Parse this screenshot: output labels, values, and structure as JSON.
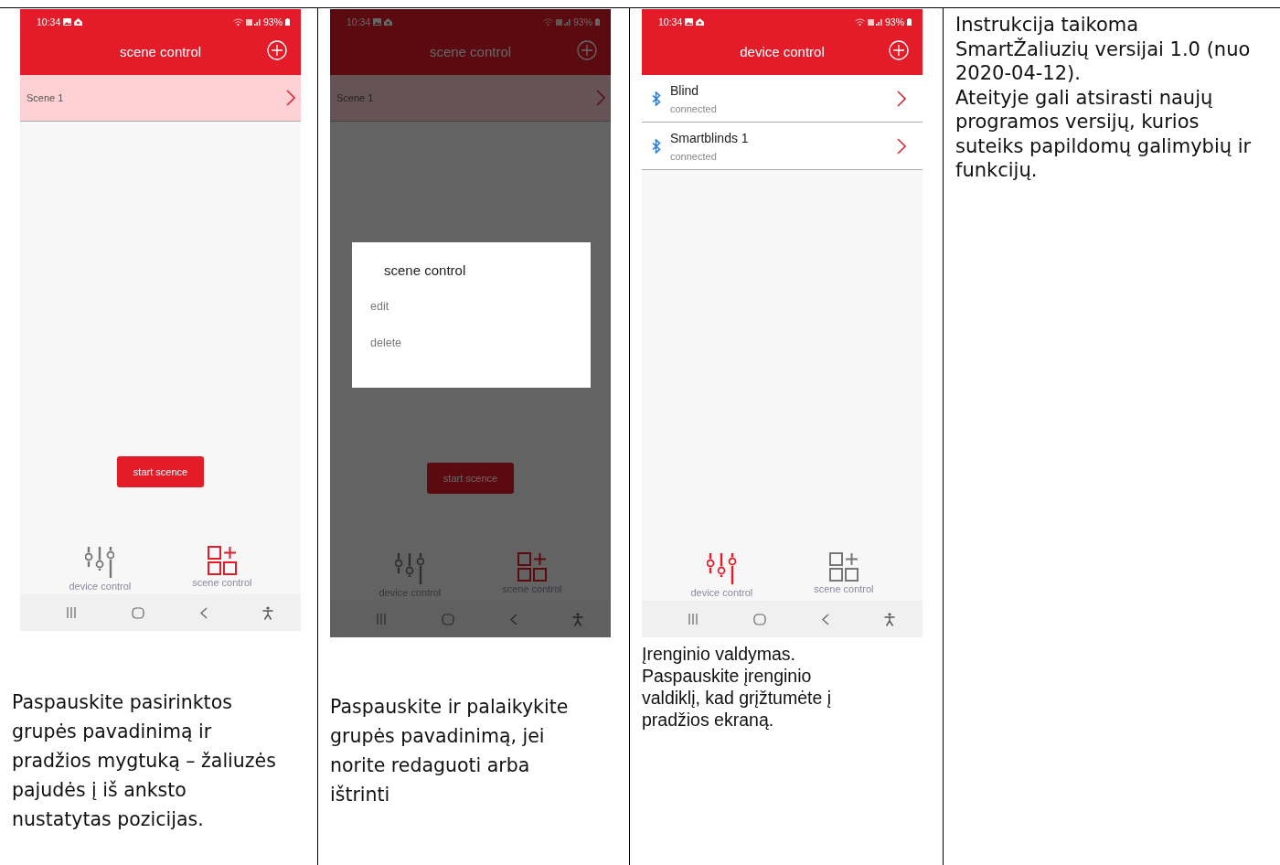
{
  "columns": [
    {
      "phone": {
        "time": "10:34",
        "battery": "93%",
        "title": "scene control",
        "dimmed": false,
        "rows": [
          {
            "kind": "scene",
            "name": "Scene 1",
            "selected": true
          }
        ],
        "button": "start scence",
        "tabs": [
          {
            "kind": "device",
            "label": "device control",
            "selected": false
          },
          {
            "kind": "scene",
            "label": "scene control",
            "selected": true
          }
        ]
      },
      "caption": "Paspauskite pasirinktos grupės pavadinimą ir pradžios mygtuką – žaliuzės pajudės į iš anksto nustatytas pozicijas."
    },
    {
      "phone": {
        "time": "10:34",
        "battery": "93%",
        "title": "scene control",
        "dimmed": true,
        "rows": [
          {
            "kind": "scene",
            "name": "Scene 1",
            "selected": true
          }
        ],
        "dialog": {
          "title": "scene control",
          "options": [
            "edit",
            "delete"
          ]
        },
        "button": "start scence",
        "tabs": [
          {
            "kind": "device",
            "label": "device control",
            "selected": false
          },
          {
            "kind": "scene",
            "label": "scene control",
            "selected": true
          }
        ]
      },
      "caption": "Paspauskite ir palaikykite grupės pavadinimą, jei norite redaguoti arba ištrinti"
    },
    {
      "phone": {
        "time": "10:34",
        "battery": "93%",
        "title": "device control",
        "dimmed": false,
        "rows": [
          {
            "kind": "device",
            "name": "Blind",
            "status": "connected",
            "selected": false
          },
          {
            "kind": "device",
            "name": "Smartblinds 1",
            "status": "connected",
            "selected": false
          }
        ],
        "tabs": [
          {
            "kind": "device",
            "label": "device control",
            "selected": true
          },
          {
            "kind": "scene",
            "label": "scene control",
            "selected": false
          }
        ]
      },
      "caption": "Įrenginio valdymas.\nPaspauskite įrenginio valdiklį, kad grįžtumėte į pradžios ekraną."
    },
    {
      "caption": "Instrukcija taikoma SmartŽaliuzių versijai 1.0 (nuo 2020-04-12).\nAteityje gali atsirasti naujų programos versijų, kurios suteiks papildomų galimybių ir funkcijų."
    }
  ]
}
